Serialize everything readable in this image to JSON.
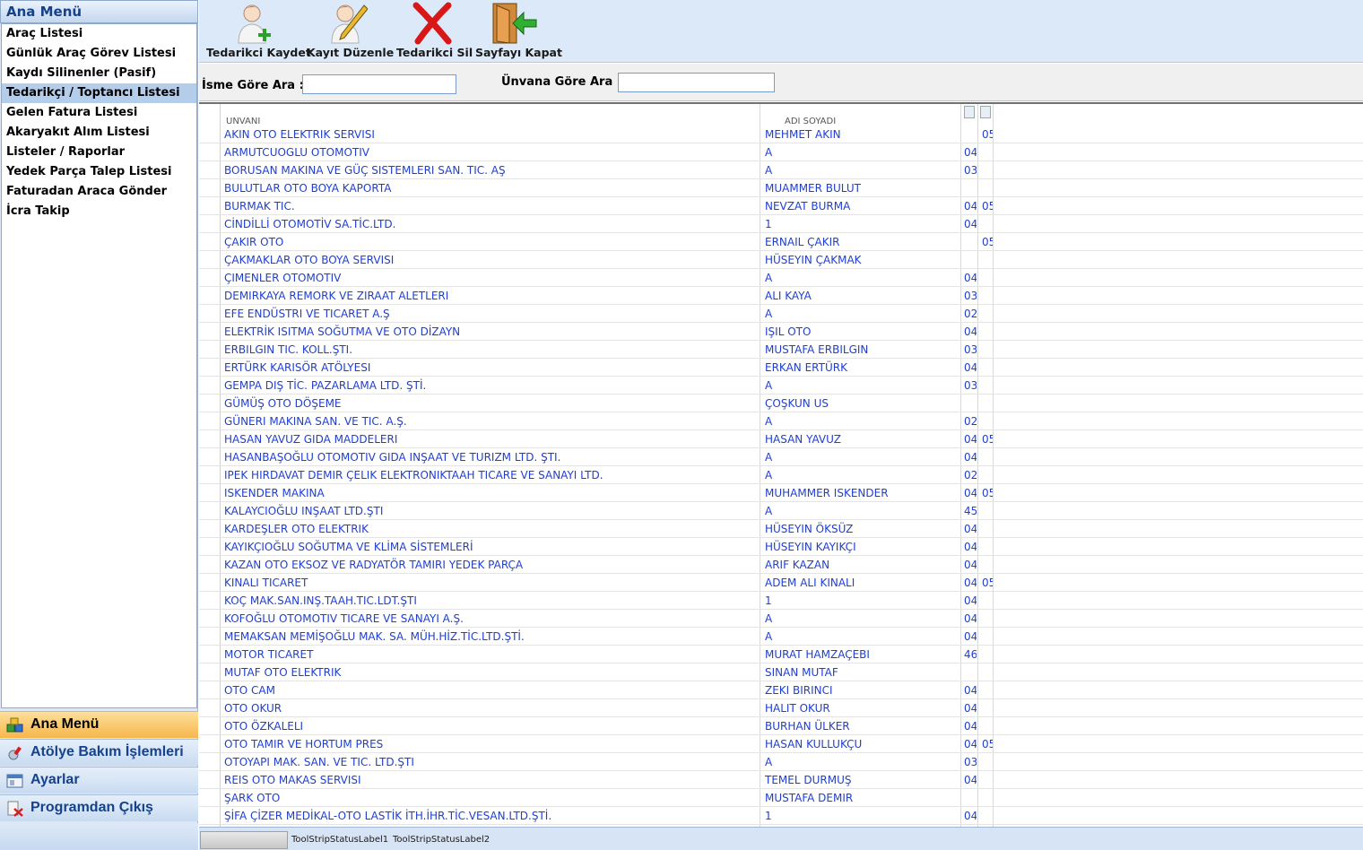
{
  "sidebar": {
    "header": "Ana Menü",
    "items": [
      {
        "label": "Araç Listesi"
      },
      {
        "label": "Günlük Araç Görev Listesi"
      },
      {
        "label": "Kaydı Silinenler (Pasif)"
      },
      {
        "label": "Tedarikçi / Toptancı Listesi",
        "selected": true
      },
      {
        "label": "Gelen Fatura Listesi"
      },
      {
        "label": "Akaryakıt Alım Listesi"
      },
      {
        "label": "Listeler / Raporlar"
      },
      {
        "label": "Yedek Parça Talep Listesi"
      },
      {
        "label": "Faturadan Araca Gönder"
      },
      {
        "label": "İcra Takip"
      }
    ],
    "sections": [
      {
        "label": "Ana Menü",
        "icon": "blocks-icon",
        "active": true
      },
      {
        "label": "Atölye Bakım İşlemleri",
        "icon": "wrench-icon"
      },
      {
        "label": "Ayarlar",
        "icon": "settings-window-icon"
      },
      {
        "label": "Programdan Çıkış",
        "icon": "exit-icon"
      }
    ]
  },
  "toolbar": {
    "buttons": [
      {
        "label": "Tedarikci Kaydet",
        "icon": "user-add-icon"
      },
      {
        "label": "Kayıt Düzenle",
        "icon": "user-edit-icon"
      },
      {
        "label": "Tedarikci Sil",
        "icon": "delete-x-icon"
      },
      {
        "label": "Sayfayı Kapat",
        "icon": "door-exit-icon"
      }
    ]
  },
  "search": {
    "name_label": "İsme Göre Ara :",
    "name_value": "",
    "title_label": "Ünvana Göre Ara :",
    "title_value": ""
  },
  "grid": {
    "columns": [
      "ÜNVANI",
      "ADI SOYADI"
    ],
    "rows": [
      {
        "title": "AKIN OTO ELEKTRIK SERVISI",
        "name": "MEHMET AKIN",
        "p1": "",
        "p2": "05"
      },
      {
        "title": "ARMUTCUOGLU OTOMOTIV",
        "name": "A",
        "p1": "04",
        "p2": ""
      },
      {
        "title": "BORUSAN MAKINA VE GÜÇ SISTEMLERI SAN. TIC. AŞ",
        "name": "A",
        "p1": "03",
        "p2": ""
      },
      {
        "title": "BULUTLAR OTO BOYA KAPORTA",
        "name": "MUAMMER BULUT",
        "p1": "",
        "p2": ""
      },
      {
        "title": "BURMAK TIC.",
        "name": "NEVZAT BURMA",
        "p1": "04",
        "p2": "05"
      },
      {
        "title": "CİNDİLLİ OTOMOTİV SA.TİC.LTD.",
        "name": "1",
        "p1": "04",
        "p2": ""
      },
      {
        "title": "ÇAKIR OTO",
        "name": "ERNAIL ÇAKIR",
        "p1": "",
        "p2": "05"
      },
      {
        "title": "ÇAKMAKLAR OTO BOYA SERVISI",
        "name": "HÜSEYIN ÇAKMAK",
        "p1": "",
        "p2": ""
      },
      {
        "title": "ÇIMENLER OTOMOTIV",
        "name": "A",
        "p1": "04",
        "p2": ""
      },
      {
        "title": "DEMIRKAYA REMORK VE ZIRAAT ALETLERI",
        "name": "ALI KAYA",
        "p1": "03",
        "p2": ""
      },
      {
        "title": "EFE ENDÜSTRI VE TICARET A.Ş",
        "name": "A",
        "p1": "02",
        "p2": ""
      },
      {
        "title": "ELEKTRİK ISITMA SOĞUTMA VE OTO DİZAYN",
        "name": "IŞIL OTO",
        "p1": "04",
        "p2": ""
      },
      {
        "title": "ERBILGIN TIC. KOLL.ŞTI.",
        "name": "MUSTAFA ERBILGIN",
        "p1": "03",
        "p2": ""
      },
      {
        "title": "ERTÜRK KARISÖR ATÖLYESI",
        "name": "ERKAN ERTÜRK",
        "p1": "04",
        "p2": ""
      },
      {
        "title": "GEMPA DIŞ TİC. PAZARLAMA LTD. ŞTİ.",
        "name": "A",
        "p1": "03",
        "p2": ""
      },
      {
        "title": "GÜMÜŞ OTO DÖŞEME",
        "name": "ÇOŞKUN US",
        "p1": "",
        "p2": ""
      },
      {
        "title": "GÜNERI MAKINA SAN. VE TIC. A.Ş.",
        "name": "A",
        "p1": "02",
        "p2": ""
      },
      {
        "title": "HASAN YAVUZ GIDA MADDELERI",
        "name": "HASAN YAVUZ",
        "p1": "04",
        "p2": "05"
      },
      {
        "title": "HASANBAŞOĞLU OTOMOTIV GIDA INŞAAT VE TURIZM LTD. ŞTI.",
        "name": "A",
        "p1": "04",
        "p2": ""
      },
      {
        "title": "IPEK HIRDAVAT DEMIR ÇELIK ELEKTRONIKTAAH TICARE VE SANAYI LTD.",
        "name": "A",
        "p1": "02",
        "p2": ""
      },
      {
        "title": "ISKENDER MAKINA",
        "name": "MUHAMMER ISKENDER",
        "p1": "04",
        "p2": "05"
      },
      {
        "title": "KALAYCIOĞLU INŞAAT LTD.ŞTI",
        "name": "A",
        "p1": "45",
        "p2": ""
      },
      {
        "title": "KARDEŞLER OTO ELEKTRIK",
        "name": "HÜSEYIN ÖKSÜZ",
        "p1": "04",
        "p2": ""
      },
      {
        "title": "KAYIKÇIOĞLU SOĞUTMA VE KLİMA SİSTEMLERİ",
        "name": "HÜSEYIN KAYIKÇI",
        "p1": "04",
        "p2": ""
      },
      {
        "title": "KAZAN OTO EKSOZ VE RADYATÖR TAMIRI YEDEK PARÇA",
        "name": "ARIF KAZAN",
        "p1": "04",
        "p2": ""
      },
      {
        "title": "KINALI TICARET",
        "name": "ADEM ALI KINALI",
        "p1": "04",
        "p2": "05"
      },
      {
        "title": "KOÇ MAK.SAN.INŞ.TAAH.TIC.LDT.ŞTI",
        "name": "1",
        "p1": "04",
        "p2": ""
      },
      {
        "title": "KOFOĞLU OTOMOTIV TICARE VE SANAYI A.Ş.",
        "name": "A",
        "p1": "04",
        "p2": ""
      },
      {
        "title": "MEMAKSAN MEMİŞOĞLU MAK. SA. MÜH.HİZ.TİC.LTD.ŞTİ.",
        "name": "A",
        "p1": "04",
        "p2": ""
      },
      {
        "title": "MOTOR TICARET",
        "name": "MURAT HAMZAÇEBI",
        "p1": "46",
        "p2": ""
      },
      {
        "title": "MUTAF OTO ELEKTRIK",
        "name": "SINAN MUTAF",
        "p1": "",
        "p2": ""
      },
      {
        "title": "OTO CAM",
        "name": "ZEKI BIRINCI",
        "p1": "04",
        "p2": ""
      },
      {
        "title": "OTO OKUR",
        "name": "HALIT OKUR",
        "p1": "04",
        "p2": ""
      },
      {
        "title": "OTO ÖZKALELI",
        "name": "BURHAN ÜLKER",
        "p1": "04",
        "p2": ""
      },
      {
        "title": "OTO TAMIR VE HORTUM PRES",
        "name": "HASAN KULLUKÇU",
        "p1": "04",
        "p2": "05"
      },
      {
        "title": "OTOYAPI MAK. SAN. VE TIC. LTD.ŞTI",
        "name": "A",
        "p1": "03",
        "p2": ""
      },
      {
        "title": "REIS OTO MAKAS SERVISI",
        "name": "TEMEL DURMUŞ",
        "p1": "04",
        "p2": ""
      },
      {
        "title": "ŞARK OTO",
        "name": "MUSTAFA DEMIR",
        "p1": "",
        "p2": ""
      },
      {
        "title": "ŞİFA ÇİZER MEDİKAL-OTO LASTİK İTH.İHR.TİC.VESAN.LTD.ŞTİ.",
        "name": "1",
        "p1": "04",
        "p2": ""
      }
    ]
  },
  "statusbar": {
    "label1": "ToolStripStatusLabel1",
    "label2": "ToolStripStatusLabel2"
  }
}
